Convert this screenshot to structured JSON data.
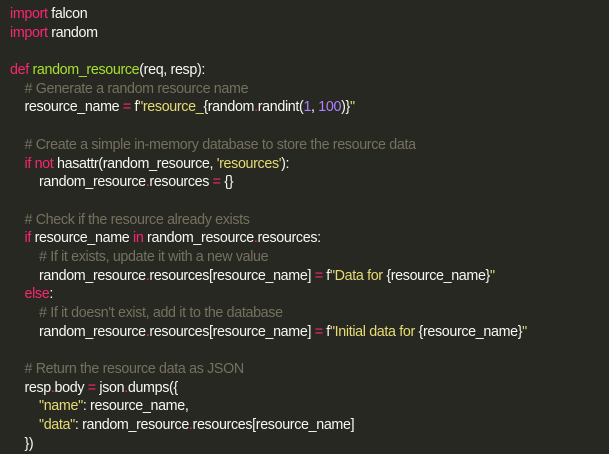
{
  "theme": {
    "background": "#272822",
    "foreground": "#f8f8f2",
    "keyword": "#f92672",
    "function": "#a6e22e",
    "comment": "#75715e",
    "string": "#e6db74",
    "number": "#ae81ff"
  },
  "code": {
    "lines": [
      [
        {
          "k": "kw",
          "t": "import"
        },
        {
          "k": "txt",
          "t": " falcon"
        }
      ],
      [
        {
          "k": "kw",
          "t": "import"
        },
        {
          "k": "txt",
          "t": " random"
        }
      ],
      [],
      [
        {
          "k": "kw",
          "t": "def"
        },
        {
          "k": "txt",
          "t": " "
        },
        {
          "k": "fn",
          "t": "random_resource"
        },
        {
          "k": "txt",
          "t": "(req, resp):"
        }
      ],
      [
        {
          "k": "cm",
          "t": "    # Generate a random resource name"
        }
      ],
      [
        {
          "k": "txt",
          "t": "    resource_name "
        },
        {
          "k": "op",
          "t": "="
        },
        {
          "k": "txt",
          "t": " f"
        },
        {
          "k": "st",
          "t": "\"resource_"
        },
        {
          "k": "txt",
          "t": "{random"
        },
        {
          "k": "op",
          "t": "."
        },
        {
          "k": "txt",
          "t": "randint("
        },
        {
          "k": "nm",
          "t": "1"
        },
        {
          "k": "txt",
          "t": ", "
        },
        {
          "k": "nm",
          "t": "100"
        },
        {
          "k": "txt",
          "t": ")}"
        },
        {
          "k": "st",
          "t": "\""
        }
      ],
      [],
      [
        {
          "k": "cm",
          "t": "    # Create a simple in-memory database to store the resource data"
        }
      ],
      [
        {
          "k": "txt",
          "t": "    "
        },
        {
          "k": "kw",
          "t": "if"
        },
        {
          "k": "txt",
          "t": " "
        },
        {
          "k": "kw",
          "t": "not"
        },
        {
          "k": "txt",
          "t": " hasattr(random_resource, "
        },
        {
          "k": "st",
          "t": "'resources'"
        },
        {
          "k": "txt",
          "t": "):"
        }
      ],
      [
        {
          "k": "txt",
          "t": "        random_resource"
        },
        {
          "k": "op",
          "t": "."
        },
        {
          "k": "txt",
          "t": "resources "
        },
        {
          "k": "op",
          "t": "="
        },
        {
          "k": "txt",
          "t": " {}"
        }
      ],
      [],
      [
        {
          "k": "cm",
          "t": "    # Check if the resource already exists"
        }
      ],
      [
        {
          "k": "txt",
          "t": "    "
        },
        {
          "k": "kw",
          "t": "if"
        },
        {
          "k": "txt",
          "t": " resource_name "
        },
        {
          "k": "kw",
          "t": "in"
        },
        {
          "k": "txt",
          "t": " random_resource"
        },
        {
          "k": "op",
          "t": "."
        },
        {
          "k": "txt",
          "t": "resources:"
        }
      ],
      [
        {
          "k": "cm",
          "t": "        # If it exists, update it with a new value"
        }
      ],
      [
        {
          "k": "txt",
          "t": "        random_resource"
        },
        {
          "k": "op",
          "t": "."
        },
        {
          "k": "txt",
          "t": "resources[resource_name] "
        },
        {
          "k": "op",
          "t": "="
        },
        {
          "k": "txt",
          "t": " f"
        },
        {
          "k": "st",
          "t": "\"Data for "
        },
        {
          "k": "txt",
          "t": "{resource_name}"
        },
        {
          "k": "st",
          "t": "\""
        }
      ],
      [
        {
          "k": "txt",
          "t": "    "
        },
        {
          "k": "kw",
          "t": "else"
        },
        {
          "k": "txt",
          "t": ":"
        }
      ],
      [
        {
          "k": "cm",
          "t": "        # If it doesn't exist, add it to the database"
        }
      ],
      [
        {
          "k": "txt",
          "t": "        random_resource"
        },
        {
          "k": "op",
          "t": "."
        },
        {
          "k": "txt",
          "t": "resources[resource_name] "
        },
        {
          "k": "op",
          "t": "="
        },
        {
          "k": "txt",
          "t": " f"
        },
        {
          "k": "st",
          "t": "\"Initial data for "
        },
        {
          "k": "txt",
          "t": "{resource_name}"
        },
        {
          "k": "st",
          "t": "\""
        }
      ],
      [],
      [
        {
          "k": "cm",
          "t": "    # Return the resource data as JSON"
        }
      ],
      [
        {
          "k": "txt",
          "t": "    resp"
        },
        {
          "k": "op",
          "t": "."
        },
        {
          "k": "txt",
          "t": "body "
        },
        {
          "k": "op",
          "t": "="
        },
        {
          "k": "txt",
          "t": " json"
        },
        {
          "k": "op",
          "t": "."
        },
        {
          "k": "txt",
          "t": "dumps({"
        }
      ],
      [
        {
          "k": "txt",
          "t": "        "
        },
        {
          "k": "st",
          "t": "\"name\""
        },
        {
          "k": "txt",
          "t": ": resource_name,"
        }
      ],
      [
        {
          "k": "txt",
          "t": "        "
        },
        {
          "k": "st",
          "t": "\"data\""
        },
        {
          "k": "txt",
          "t": ": random_resource"
        },
        {
          "k": "op",
          "t": "."
        },
        {
          "k": "txt",
          "t": "resources[resource_name]"
        }
      ],
      [
        {
          "k": "txt",
          "t": "    })"
        }
      ]
    ]
  }
}
